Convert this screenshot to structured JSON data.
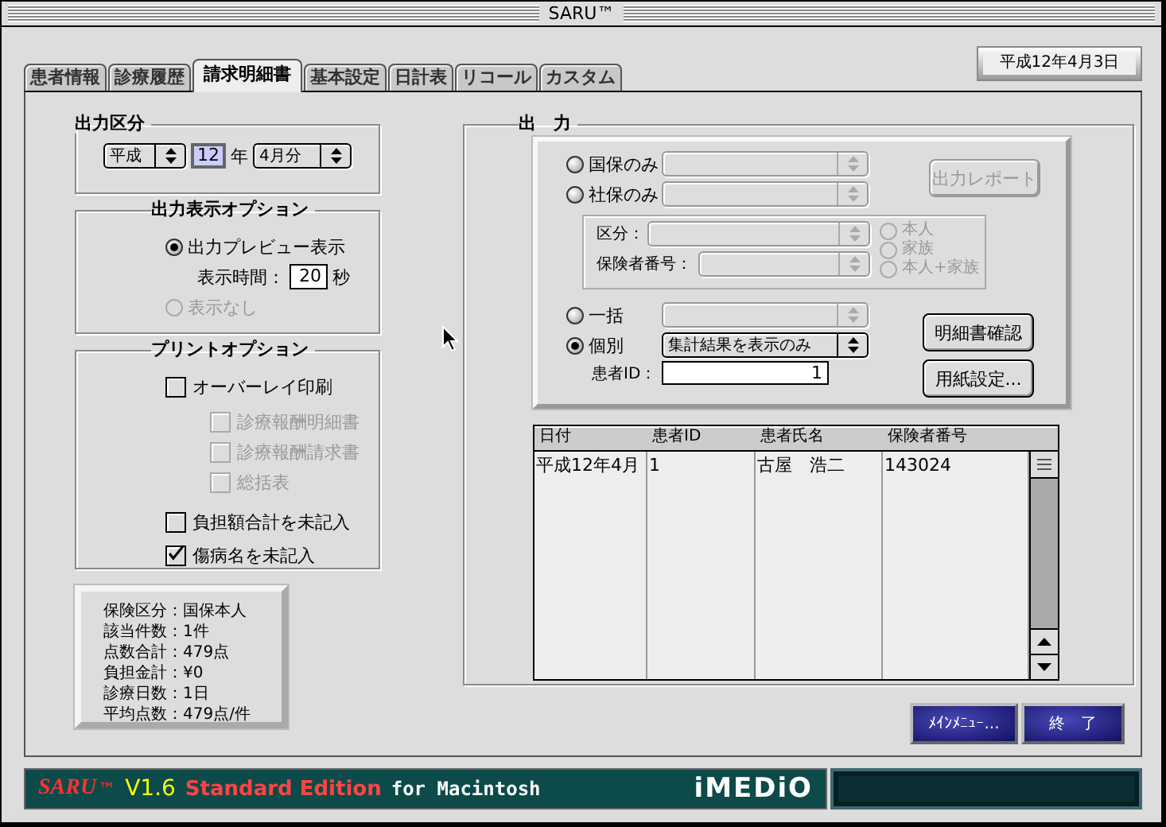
{
  "window": {
    "title": "SARU™"
  },
  "tabs": [
    {
      "label": "患者情報",
      "selected": false
    },
    {
      "label": "診療履歴",
      "selected": false
    },
    {
      "label": "請求明細書",
      "selected": true
    },
    {
      "label": "基本設定",
      "selected": false
    },
    {
      "label": "日計表",
      "selected": false
    },
    {
      "label": "リコール",
      "selected": false
    },
    {
      "label": "カスタム",
      "selected": false
    }
  ],
  "date": "平成12年4月3日",
  "output_category": {
    "title": "出力区分",
    "era": {
      "value": "平成",
      "disabled": false
    },
    "year": "12",
    "year_unit": "年",
    "month": {
      "value": "4月分",
      "disabled": false
    }
  },
  "display_options": {
    "title": "出力表示オプション",
    "options": [
      {
        "label": "出力プレビュー表示",
        "selected": true,
        "disabled": false
      },
      {
        "label": "表示なし",
        "selected": false,
        "disabled": true
      }
    ],
    "time_label": "表示時間：",
    "time": "20",
    "time_unit": "秒"
  },
  "print_options": {
    "title": "プリントオプション",
    "items": [
      {
        "label": "オーバーレイ印刷",
        "checked": false,
        "disabled": false,
        "children": [
          {
            "label": "診療報酬明細書",
            "checked": false,
            "disabled": true
          },
          {
            "label": "診療報酬請求書",
            "checked": false,
            "disabled": true
          },
          {
            "label": "総括表",
            "checked": false,
            "disabled": true
          }
        ]
      },
      {
        "label": "負担額合計を未記入",
        "checked": false,
        "disabled": false
      },
      {
        "label": "傷病名を未記入",
        "checked": true,
        "disabled": false
      }
    ]
  },
  "summary": [
    "保険区分：国保本人",
    "該当件数：1件",
    "点数合計：479点",
    "負担金計：¥0",
    "診療日数：1日",
    "平均点数：479点/件"
  ],
  "output": {
    "title": "出　力",
    "insurance": [
      {
        "label": "国保のみ",
        "selected": false,
        "disabled": false,
        "popup": {
          "disabled": true
        }
      },
      {
        "label": "社保のみ",
        "selected": false,
        "disabled": false,
        "popup": {
          "disabled": true
        }
      }
    ],
    "report_button": {
      "label": "出力レポート",
      "disabled": true
    },
    "filters": [
      {
        "label": "区分：",
        "popup": {
          "disabled": true
        }
      },
      {
        "label": "保険者番号：",
        "popup": {
          "disabled": true
        }
      }
    ],
    "persons": [
      {
        "label": "本人",
        "selected": false,
        "disabled": true
      },
      {
        "label": "家族",
        "selected": false,
        "disabled": true
      },
      {
        "label": "本人+家族",
        "selected": false,
        "disabled": true
      }
    ],
    "modes": [
      {
        "label": "一括",
        "selected": false,
        "disabled": false,
        "popup": {
          "disabled": true
        }
      },
      {
        "label": "個別",
        "selected": true,
        "disabled": false,
        "popup": {
          "value": "集計結果を表示のみ",
          "disabled": false
        }
      }
    ],
    "patient_id_label": "患者ID：",
    "patient_id": "1",
    "buttons": [
      "明細書確認",
      "用紙設定..."
    ]
  },
  "table": {
    "columns": [
      "日付",
      "患者ID",
      "患者氏名",
      "保険者番号"
    ],
    "rows": [
      [
        "平成12年4月",
        "1",
        "古屋　浩二",
        "143024"
      ]
    ]
  },
  "buttons": [
    "ﾒｲﾝﾒﾆｭｰ...",
    "終　了"
  ],
  "footer": {
    "brand": "SARU",
    "trademark": "™",
    "version": "V1.6",
    "edition": "Standard Edition",
    "platform": "for Macintosh",
    "logo": "iMEDiO"
  }
}
